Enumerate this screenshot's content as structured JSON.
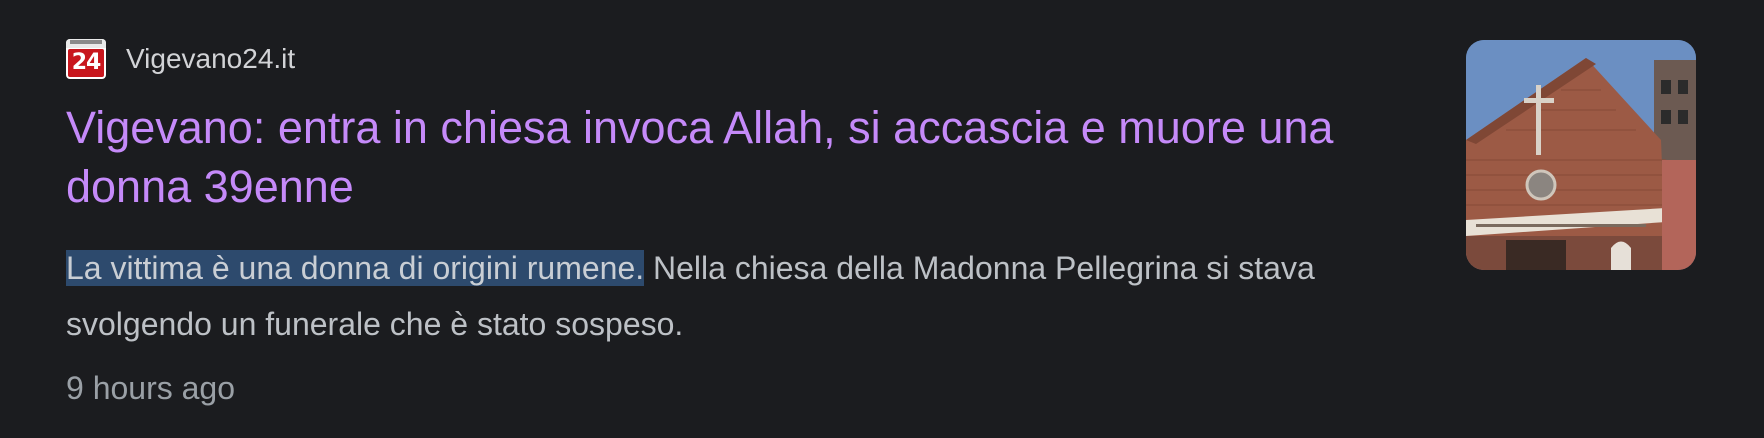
{
  "source": {
    "favicon_icon": "vigevano24-logo-icon",
    "favicon_text": "24",
    "name": "Vigevano24.it"
  },
  "article": {
    "title": "Vigevano: entra in chiesa invoca Allah, si accascia e muore una donna 39enne",
    "snippet_highlighted": "La vittima è una donna di origini rumene.",
    "snippet_rest": " Nella chiesa della Madonna Pellegrina si stava svolgendo un funerale che è stato sospeso.",
    "time": "9 hours ago",
    "thumbnail_icon": "church-photo-thumbnail"
  },
  "colors": {
    "background": "#1b1c1f",
    "title": "#c58af9",
    "snippet": "#bdc1c6",
    "selection": "#2d4a6d",
    "meta": "#9aa0a6"
  }
}
